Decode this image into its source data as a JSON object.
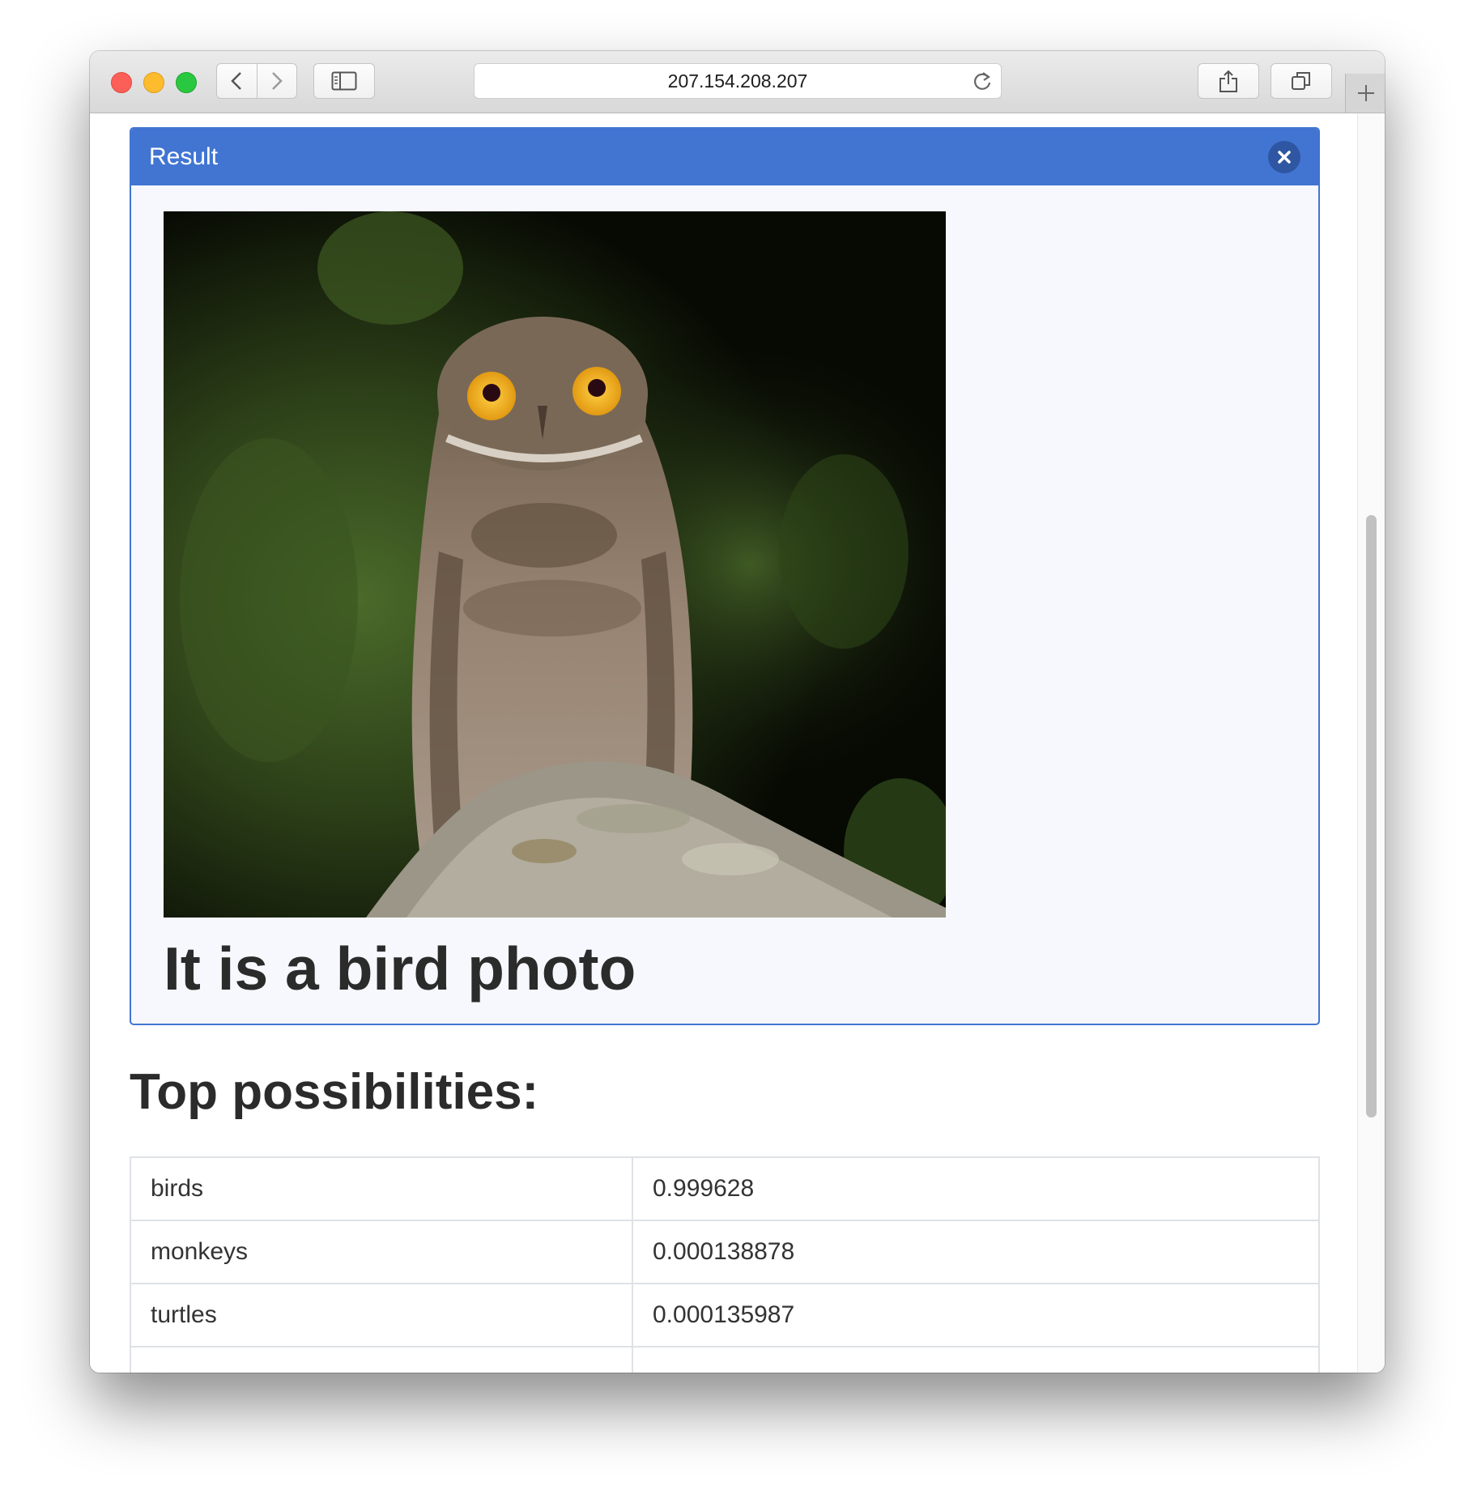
{
  "browser": {
    "url": "207.154.208.207"
  },
  "result_panel": {
    "title": "Result",
    "caption": "It is a bird photo"
  },
  "possibilities": {
    "heading": "Top possibilities:",
    "rows": [
      {
        "label": "birds",
        "value": "0.999628"
      },
      {
        "label": "monkeys",
        "value": "0.000138878"
      },
      {
        "label": "turtles",
        "value": "0.000135987"
      },
      {
        "label": "",
        "value": ""
      }
    ]
  },
  "colors": {
    "accent": "#4275d2",
    "panel_bg": "#f6f8fd",
    "text": "#2b2b2b"
  },
  "icons": [
    "back-chevron-icon",
    "forward-chevron-icon",
    "sidebar-icon",
    "reload-icon",
    "share-icon",
    "tabs-icon",
    "plus-icon",
    "close-icon"
  ]
}
